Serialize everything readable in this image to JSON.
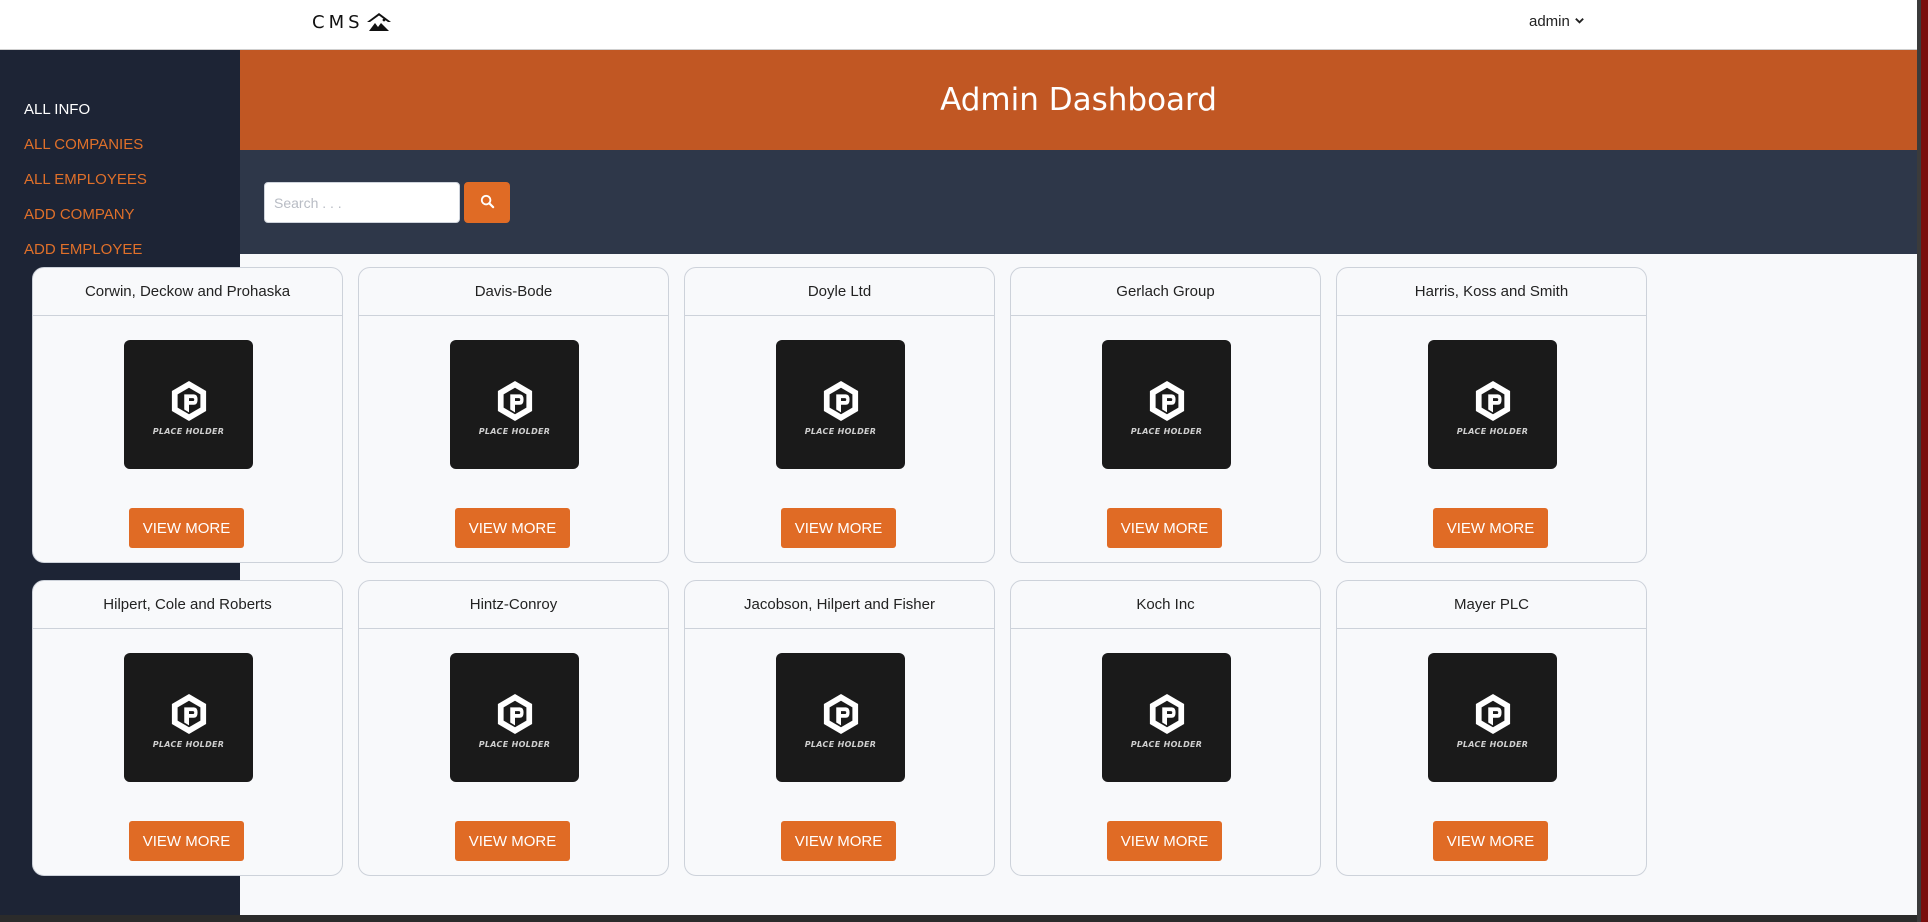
{
  "brand": {
    "name": "CMS",
    "icon": "mountain-house-icon"
  },
  "user_menu": {
    "label": "admin",
    "icon": "chevron-down-icon"
  },
  "sidebar": {
    "items": [
      {
        "label": "ALL INFO",
        "active": true
      },
      {
        "label": "ALL COMPANIES",
        "active": false
      },
      {
        "label": "ALL EMPLOYEES",
        "active": false
      },
      {
        "label": "ADD COMPANY",
        "active": false
      },
      {
        "label": "ADD EMPLOYEE",
        "active": false
      }
    ]
  },
  "header": {
    "title": "Admin Dashboard"
  },
  "search": {
    "placeholder": "Search . . .",
    "value": "",
    "button_icon": "search-icon"
  },
  "placeholder_image": {
    "text": "PLACE HOLDER"
  },
  "companies": [
    {
      "name": "Corwin, Deckow and Prohaska",
      "button": "VIEW MORE"
    },
    {
      "name": "Davis-Bode",
      "button": "VIEW MORE"
    },
    {
      "name": "Doyle Ltd",
      "button": "VIEW MORE"
    },
    {
      "name": "Gerlach Group",
      "button": "VIEW MORE"
    },
    {
      "name": "Harris, Koss and Smith",
      "button": "VIEW MORE"
    },
    {
      "name": "Hilpert, Cole and Roberts",
      "button": "VIEW MORE"
    },
    {
      "name": "Hintz-Conroy",
      "button": "VIEW MORE"
    },
    {
      "name": "Jacobson, Hilpert and Fisher",
      "button": "VIEW MORE"
    },
    {
      "name": "Koch Inc",
      "button": "VIEW MORE"
    },
    {
      "name": "Mayer PLC",
      "button": "VIEW MORE"
    }
  ],
  "colors": {
    "accent": "#e06b25",
    "hero": "#c15723",
    "sidebar": "#1d2435",
    "search_band": "#2e3749"
  }
}
